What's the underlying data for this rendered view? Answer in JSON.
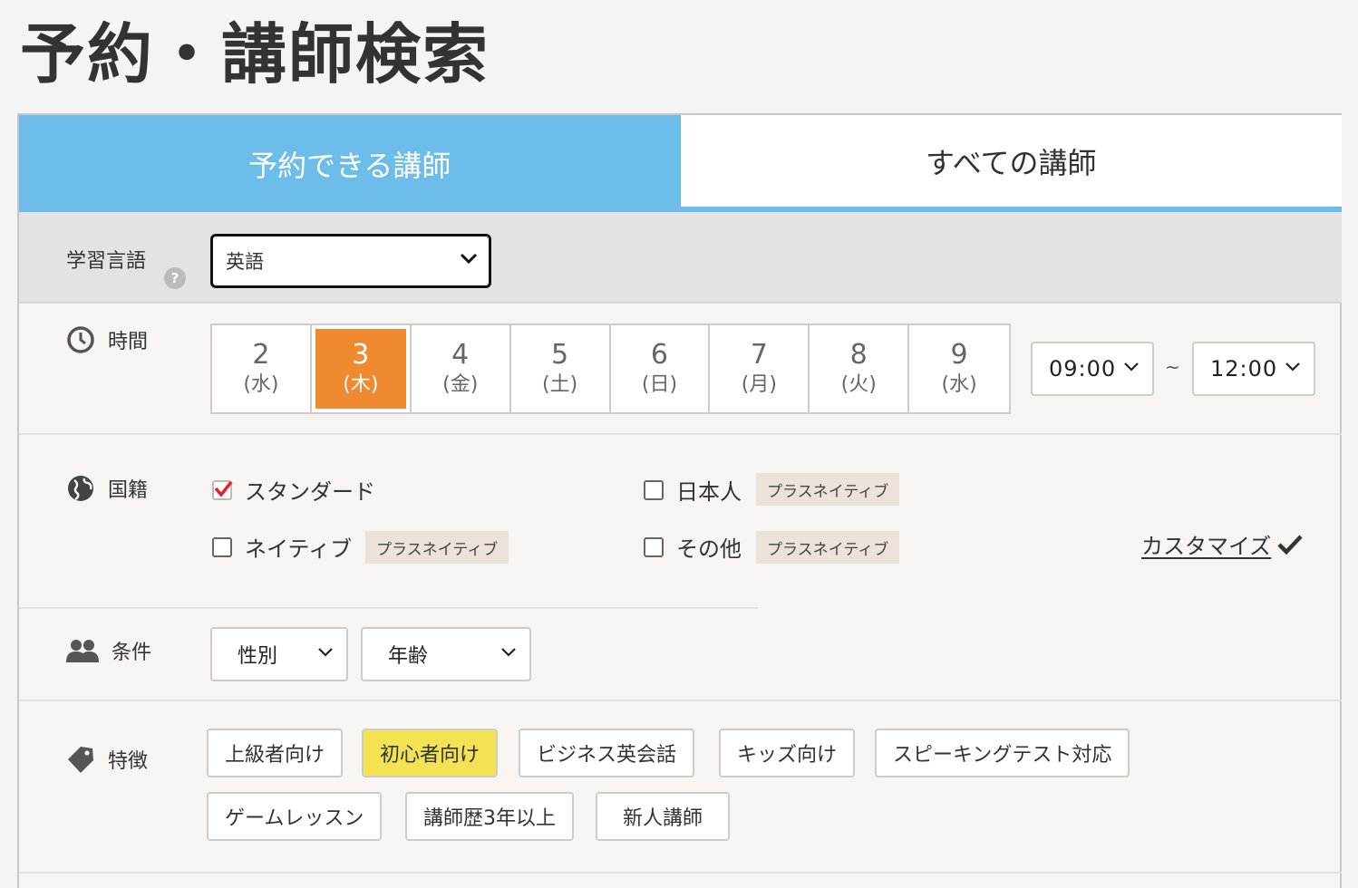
{
  "page": {
    "title": "予約・講師検索"
  },
  "tabs": [
    {
      "label": "予約できる講師",
      "active": true
    },
    {
      "label": "すべての講師",
      "active": false
    }
  ],
  "language": {
    "label": "学習言語",
    "selected": "英語"
  },
  "time": {
    "label": "時間",
    "dates": [
      {
        "num": "2",
        "day": "(水)"
      },
      {
        "num": "3",
        "day": "(木)"
      },
      {
        "num": "4",
        "day": "(金)"
      },
      {
        "num": "5",
        "day": "(土)"
      },
      {
        "num": "6",
        "day": "(日)"
      },
      {
        "num": "7",
        "day": "(月)"
      },
      {
        "num": "8",
        "day": "(火)"
      },
      {
        "num": "9",
        "day": "(水)"
      }
    ],
    "selected_index": 1,
    "from": "09:00",
    "separator": "~",
    "to": "12:00"
  },
  "nationality": {
    "label": "国籍",
    "help": "?",
    "options": [
      {
        "label": "スタンダード",
        "checked": true,
        "badge": ""
      },
      {
        "label": "日本人",
        "checked": false,
        "badge": "プラスネイティブ"
      },
      {
        "label": "ネイティブ",
        "checked": false,
        "badge": "プラスネイティブ"
      },
      {
        "label": "その他",
        "checked": false,
        "badge": "プラスネイティブ"
      }
    ],
    "customize_label": "カスタマイズ"
  },
  "conditions": {
    "label": "条件",
    "gender": "性別",
    "age": "年齢"
  },
  "features": {
    "label": "特徴",
    "chips": [
      {
        "label": "上級者向け",
        "active": false
      },
      {
        "label": "初心者向け",
        "active": true
      },
      {
        "label": "ビジネス英会話",
        "active": false
      },
      {
        "label": "キッズ向け",
        "active": false
      },
      {
        "label": "スピーキングテスト対応",
        "active": false
      },
      {
        "label": "ゲームレッスン",
        "active": false
      },
      {
        "label": "講師歴3年以上",
        "active": false
      },
      {
        "label": "新人講師",
        "active": false
      }
    ]
  },
  "colors": {
    "tab_active": "#6cbde9",
    "date_selected": "#f08a30",
    "chip_active": "#f3e353",
    "checkmark": "#e0222a"
  }
}
